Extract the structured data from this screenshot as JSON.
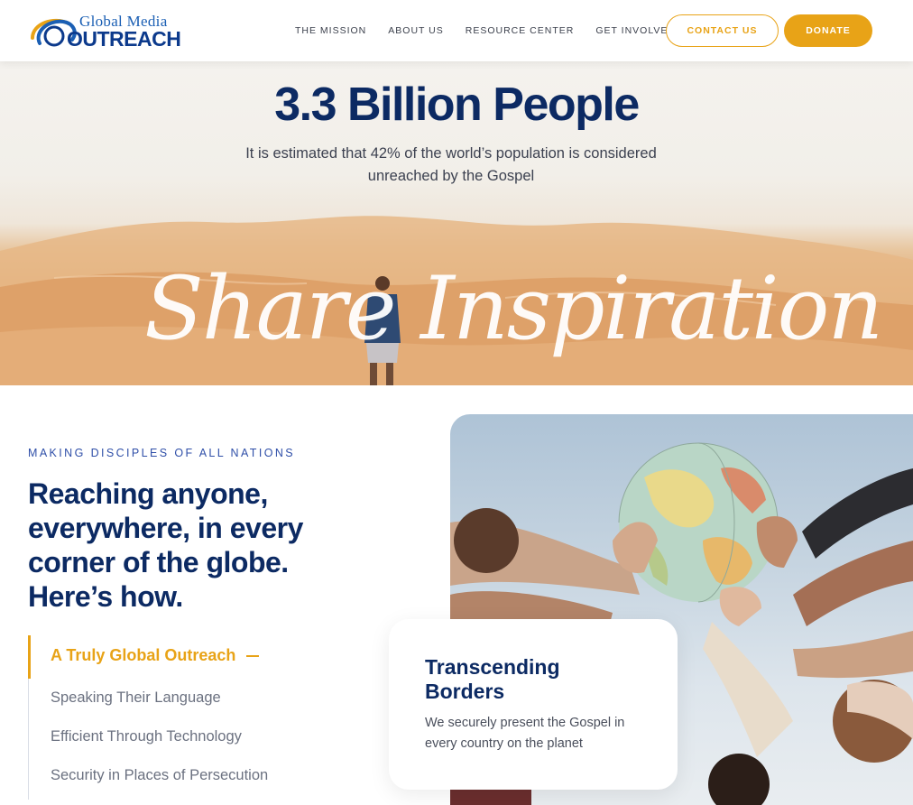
{
  "brand": {
    "logo_line1": "Global Media",
    "logo_line2": "OUTREACH",
    "colors": {
      "navy": "#0c2a63",
      "gold": "#e8a317",
      "blue": "#1b5fb4"
    }
  },
  "nav": {
    "items": [
      {
        "label": "THE MISSION"
      },
      {
        "label": "ABOUT US"
      },
      {
        "label": "RESOURCE CENTER"
      },
      {
        "label": "GET INVOLVED"
      }
    ],
    "contact_label": "CONTACT US",
    "donate_label": "DONATE"
  },
  "hero": {
    "title": "3.3 Billion People",
    "subtitle": "It is estimated that 42% of the world’s population is considered unreached by the Gospel",
    "script_text": "Share Inspiration"
  },
  "section": {
    "eyebrow": "MAKING DISCIPLES OF ALL NATIONS",
    "heading": "Reaching anyone, everywhere, in every corner of the globe. Here’s how.",
    "list": [
      {
        "label": "A Truly Global Outreach",
        "active": true
      },
      {
        "label": "Speaking Their Language"
      },
      {
        "label": "Efficient Through Technology"
      },
      {
        "label": "Security in Places of Persecution"
      }
    ]
  },
  "card": {
    "title": "Transcending Borders",
    "text": "We securely present the Gospel in every country on the planet"
  },
  "icons": [
    "logo-swoosh-icon",
    "active-dash-icon"
  ]
}
